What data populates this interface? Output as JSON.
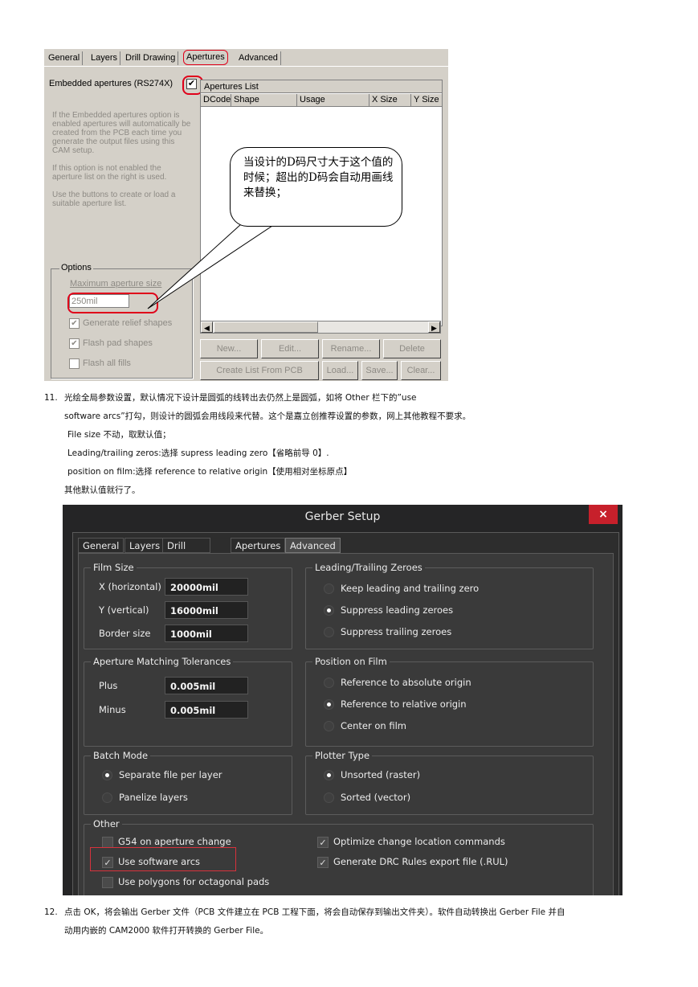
{
  "classic_dialog": {
    "tabs": [
      "General",
      "Layers",
      "Drill Drawing",
      "Apertures",
      "Advanced"
    ],
    "active_tab": "Apertures",
    "embedded_label": "Embedded apertures (RS274X)",
    "embedded_checked": true,
    "help_paragraphs": [
      "If the Embedded apertures option is enabled apertures will automatically be created from the PCB each time you generate the output files using this CAM setup.",
      "If this option is not enabled the aperture list on the right is used.",
      "Use the buttons to create or load a suitable aperture list."
    ],
    "list_title": "Apertures List",
    "columns": [
      "DCode",
      "Shape",
      "Usage",
      "X Size",
      "Y Size"
    ],
    "options_legend": "Options",
    "max_aperture_label": "Maximum aperture size",
    "max_aperture_value": "250mil",
    "checks": [
      {
        "label": "Generate relief shapes",
        "checked": true
      },
      {
        "label": "Flash pad shapes",
        "checked": true
      },
      {
        "label": "Flash all fills",
        "checked": false
      }
    ],
    "buttons_row1": [
      "New...",
      "Edit...",
      "Rename...",
      "Delete"
    ],
    "buttons_row2": [
      "Create List From PCB",
      "Load...",
      "Save...",
      "Clear..."
    ],
    "callout_text": "当设计的D码尺寸大于这个值的时候；超出的D码会自动用画线来替换；"
  },
  "doc": {
    "step11_num": "11.",
    "step11_line1": "光绘全局参数设置，默认情况下设计是圆弧的线转出去仍然上是圆弧，如将 Other 栏下的”use",
    "step11_line2": "software arcs”打勾，则设计的圆弧会用线段来代替。这个是嘉立创推荐设置的参数，网上其他教程不要求。",
    "step11_line3": "File size 不动，取默认值；",
    "step11_line4": "Leading/trailing zeros:选择 supress leading zero【省略前导 0】.",
    "step11_line5": "position on film:选择 reference to relative origin【使用相对坐标原点】",
    "step11_line6": "其他默认值就行了。",
    "step12_num": "12.",
    "step12_line1": "点击 OK，将会输出 Gerber 文件（PCB 文件建立在 PCB 工程下面，将会自动保存到输出文件夹）。软件自动转换出 Gerber File 并自",
    "step12_line2": "动用内嵌的 CAM2000 软件打开转换的 Gerber File。"
  },
  "gerber_setup": {
    "title": "Gerber Setup",
    "close_label": "×",
    "tabs": [
      "General",
      "Layers",
      "Drill Drawing",
      "Apertures",
      "Advanced"
    ],
    "active_tab": "Advanced",
    "film_size": {
      "legend": "Film Size",
      "rows": [
        {
          "label": "X (horizontal)",
          "value": "20000mil"
        },
        {
          "label": "Y (vertical)",
          "value": "16000mil"
        },
        {
          "label": "Border size",
          "value": "1000mil"
        }
      ]
    },
    "aperture_tol": {
      "legend": "Aperture Matching Tolerances",
      "rows": [
        {
          "label": "Plus",
          "value": "0.005mil"
        },
        {
          "label": "Minus",
          "value": "0.005mil"
        }
      ]
    },
    "batch_mode": {
      "legend": "Batch Mode",
      "options": [
        {
          "label": "Separate file per layer",
          "selected": true
        },
        {
          "label": "Panelize layers",
          "selected": false
        }
      ]
    },
    "zeroes": {
      "legend": "Leading/Trailing Zeroes",
      "options": [
        {
          "label": "Keep leading and trailing zero",
          "selected": false
        },
        {
          "label": "Suppress leading zeroes",
          "selected": true
        },
        {
          "label": "Suppress trailing zeroes",
          "selected": false
        }
      ]
    },
    "position": {
      "legend": "Position on Film",
      "options": [
        {
          "label": "Reference to absolute origin",
          "selected": false
        },
        {
          "label": "Reference to relative origin",
          "selected": true
        },
        {
          "label": "Center on film",
          "selected": false
        }
      ]
    },
    "plotter": {
      "legend": "Plotter Type",
      "options": [
        {
          "label": "Unsorted (raster)",
          "selected": true
        },
        {
          "label": "Sorted (vector)",
          "selected": false
        }
      ]
    },
    "other": {
      "legend": "Other",
      "left": [
        {
          "label": "G54 on aperture change",
          "checked": false
        },
        {
          "label": "Use software arcs",
          "checked": true
        },
        {
          "label": "Use polygons for octagonal pads",
          "checked": false
        }
      ],
      "right": [
        {
          "label": "Optimize change location commands",
          "checked": true
        },
        {
          "label": "Generate DRC Rules export file (.RUL)",
          "checked": true
        }
      ]
    }
  }
}
